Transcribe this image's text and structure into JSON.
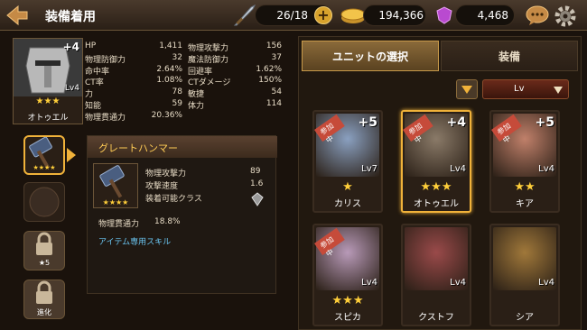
{
  "header": {
    "title": "装備着用",
    "weapon_count": "26/18",
    "gold": "194,366",
    "gems": "4,468"
  },
  "hero": {
    "name": "オトゥエル",
    "plus": "+4",
    "lv": "Lv4",
    "stars": "★★★",
    "stats_left": [
      {
        "label": "HP",
        "value": "1,411"
      },
      {
        "label": "物理防御力",
        "value": "32"
      },
      {
        "label": "命中率",
        "value": "2.64%"
      },
      {
        "label": "CT率",
        "value": "1.08%"
      },
      {
        "label": "力",
        "value": "78"
      },
      {
        "label": "知能",
        "value": "59"
      },
      {
        "label": "物理貫通力",
        "value": "20.36%"
      }
    ],
    "stats_right": [
      {
        "label": "物理攻撃力",
        "value": "156"
      },
      {
        "label": "魔法防御力",
        "value": "37"
      },
      {
        "label": "回避率",
        "value": "1.62%"
      },
      {
        "label": "CTダメージ",
        "value": "150%"
      },
      {
        "label": "敏捷",
        "value": "54"
      },
      {
        "label": "体力",
        "value": "114"
      }
    ]
  },
  "side_slots": {
    "slot3_label": "★5",
    "slot4_label": "進化"
  },
  "weapon": {
    "name": "グレートハンマー",
    "stars": "★★★★",
    "stats": [
      {
        "label": "物理攻撃力",
        "value": "89"
      },
      {
        "label": "攻撃速度",
        "value": "1.6"
      },
      {
        "label": "装着可能クラス",
        "value": ""
      }
    ],
    "sub_label": "物理貫通力",
    "sub_value": "18.8%",
    "skill_label": "アイテム専用スキル"
  },
  "tabs": {
    "unit_select": "ユニットの選択",
    "equip": "装備"
  },
  "sort": {
    "selected": "Lv"
  },
  "units": [
    {
      "name": "カリス",
      "lv": "Lv7",
      "plus": "+5",
      "stars": "★",
      "badge": "参加中",
      "selected": false,
      "color": "#8aa0c0"
    },
    {
      "name": "オトゥエル",
      "lv": "Lv4",
      "plus": "+4",
      "stars": "★★★",
      "badge": "参加中",
      "selected": true,
      "color": "#8a7a68"
    },
    {
      "name": "キア",
      "lv": "Lv4",
      "plus": "+5",
      "stars": "★★",
      "badge": "参加中",
      "selected": false,
      "color": "#c0806a"
    },
    {
      "name": "スピカ",
      "lv": "Lv4",
      "plus": "",
      "stars": "★★★",
      "badge": "参加中",
      "selected": false,
      "color": "#b89ab8"
    },
    {
      "name": "クストフ",
      "lv": "Lv4",
      "plus": "",
      "stars": "",
      "badge": "",
      "selected": false,
      "color": "#9a4a4a"
    },
    {
      "name": "シア",
      "lv": "Lv4",
      "plus": "",
      "stars": "",
      "badge": "",
      "selected": false,
      "color": "#a0783a"
    }
  ],
  "colors": {
    "accent": "#f0b23a",
    "bg": "#1a120c",
    "gold_text": "#ffcc55"
  }
}
